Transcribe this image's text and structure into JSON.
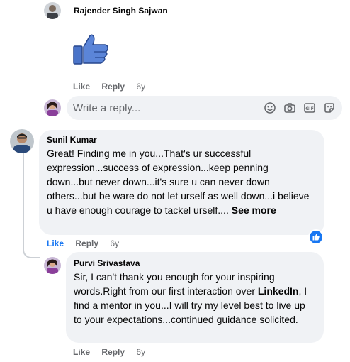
{
  "top_comment": {
    "author": "Rajender Singh Sajwan",
    "sticker": "thumbs-up-sticker",
    "actions": {
      "like": "Like",
      "reply": "Reply",
      "time": "6y"
    }
  },
  "reply_composer": {
    "placeholder": "Write a reply...",
    "icons": [
      "smiley-icon",
      "camera-icon",
      "gif-icon",
      "sticker-icon"
    ]
  },
  "comment_sunil": {
    "author": "Sunil Kumar",
    "text": "Great! Finding me in you...That's ur successful expression...success of expression...keep penning down...but never down...it's sure u can never down others...but be ware do not let urself as well down...i believe u have enough courage to tackel urself....",
    "see_more": "See more",
    "actions": {
      "like": "Like",
      "reply": "Reply",
      "time": "6y"
    },
    "reaction": "like-reaction"
  },
  "reply_purvi": {
    "author": "Purvi Srivastava",
    "text_before": "Sir, I can't thank you enough for your inspiring words.Right from our first interaction over ",
    "mention": "LinkedIn",
    "text_after": ", I find a mentor in you...I will try my level best to live up to your expectations...continued guidance solicited.",
    "actions": {
      "like": "Like",
      "reply": "Reply",
      "time": "6y"
    }
  },
  "colors": {
    "bubble": "#f0f2f5",
    "secondary_text": "#65676b",
    "accent_blue": "#1877f2"
  }
}
